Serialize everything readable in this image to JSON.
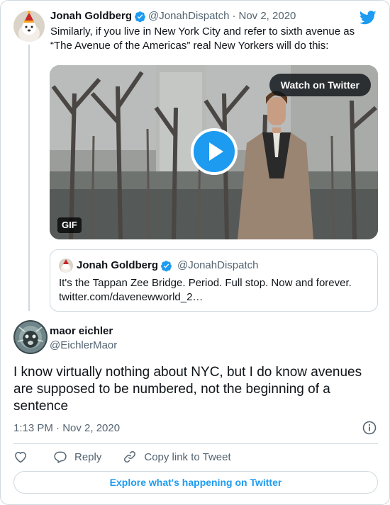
{
  "colors": {
    "accent": "#1d9bf0",
    "secondary_text": "#536471",
    "border": "#cfd9de"
  },
  "parent_tweet": {
    "name": "Jonah Goldberg",
    "handle": "@JonahDispatch",
    "separator": "·",
    "date": "Nov 2, 2020",
    "text": "Similarly, if you live in New York City and refer to sixth avenue as “The Avenue of the Americas” real New Yorkers will do this:",
    "media": {
      "watch_label": "Watch on Twitter",
      "badge": "GIF"
    }
  },
  "quoted_tweet": {
    "name": "Jonah Goldberg",
    "handle": "@JonahDispatch",
    "text": "It's the Tappan Zee Bridge. Period. Full stop. Now and forever.",
    "link": "twitter.com/davenewworld_2…"
  },
  "main_tweet": {
    "name": "maor eichler",
    "handle": "@EichlerMaor",
    "text": "I know virtually nothing about NYC, but I do know avenues are supposed to be numbered, not the beginning of a sentence",
    "time": "1:13 PM · Nov 2, 2020"
  },
  "actions": {
    "reply": "Reply",
    "copy_link": "Copy link to Tweet"
  },
  "footer": {
    "explore": "Explore what's happening on Twitter"
  },
  "icons": [
    "twitter-bird-icon",
    "verified-badge-icon",
    "play-icon",
    "info-icon",
    "heart-icon",
    "reply-icon",
    "link-icon"
  ]
}
